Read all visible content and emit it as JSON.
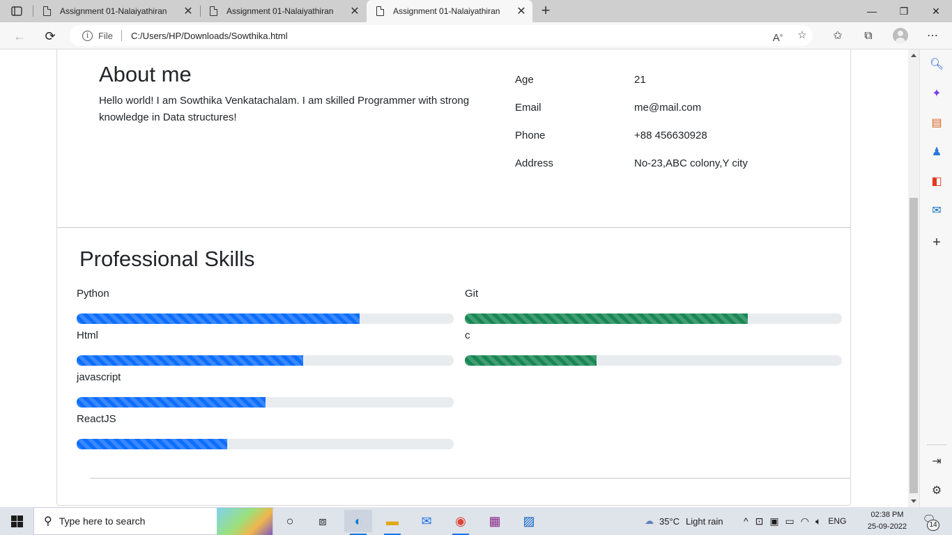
{
  "browser": {
    "tabs": [
      {
        "title": "Assignment 01-Nalaiyathiran",
        "active": false
      },
      {
        "title": "Assignment 01-Nalaiyathiran",
        "active": false
      },
      {
        "title": "Assignment 01-Nalaiyathiran",
        "active": true
      }
    ],
    "new_tab_symbol": "+",
    "file_label": "File",
    "url": "C:/Users/HP/Downloads/Sowthika.html",
    "window_controls": {
      "minimize": "—",
      "restore": "❐",
      "close": "✕"
    }
  },
  "about": {
    "title": "About me",
    "text": "Hello world! I am Sowthika Venkatachalam. I am skilled Programmer with strong knowledge in Data structures!",
    "info": [
      {
        "label": "Age",
        "value": "21"
      },
      {
        "label": "Email",
        "value": "me@mail.com"
      },
      {
        "label": "Phone",
        "value": "+88 456630928"
      },
      {
        "label": "Address",
        "value": "No-23,ABC colony,Y city"
      }
    ]
  },
  "skills": {
    "title": "Professional Skills",
    "left": [
      {
        "name": "Python",
        "level": 75
      },
      {
        "name": "Html",
        "level": 60
      },
      {
        "name": "javascript",
        "level": 50
      },
      {
        "name": "ReactJS",
        "level": 40
      }
    ],
    "right": [
      {
        "name": "Git",
        "level": 75
      },
      {
        "name": "c",
        "level": 35
      }
    ],
    "left_color": "#0d6efd",
    "right_color": "#198754"
  },
  "taskbar": {
    "search_placeholder": "Type here to search",
    "weather_temp": "35°C",
    "weather_text": "Light rain",
    "language": "ENG",
    "time": "02:38 PM",
    "date": "25-09-2022",
    "notification_count": "14"
  }
}
